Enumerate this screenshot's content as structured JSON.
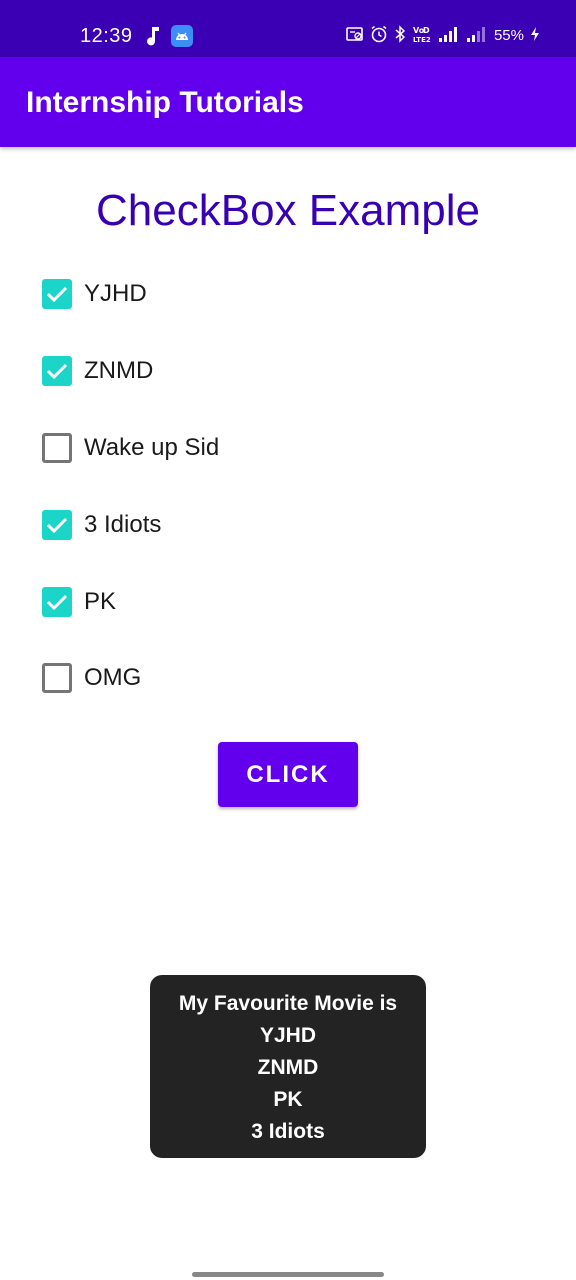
{
  "status_bar": {
    "time": "12:39",
    "battery": "55%",
    "colors": {
      "background": "#3b00b3",
      "foreground": "#ffffff"
    },
    "icons": [
      "music-note-icon",
      "android-app-icon",
      "media-icon",
      "alarm-icon",
      "bluetooth-icon",
      "volte-icon",
      "signal-icon",
      "signal-weak-icon",
      "charging-icon"
    ]
  },
  "app_bar": {
    "title": "Internship Tutorials",
    "color": "#6200ee"
  },
  "main": {
    "heading": "CheckBox Example",
    "heading_color": "#3700b3",
    "checkboxes": [
      {
        "label": "YJHD",
        "checked": true
      },
      {
        "label": "ZNMD",
        "checked": true
      },
      {
        "label": "Wake up Sid",
        "checked": false
      },
      {
        "label": "3 Idiots",
        "checked": true
      },
      {
        "label": "PK",
        "checked": true
      },
      {
        "label": "OMG",
        "checked": false
      }
    ],
    "checkbox_color": "#1bd6c8",
    "button_label": "CLICK"
  },
  "toast": {
    "lines": [
      "My Favourite Movie is",
      "YJHD",
      "ZNMD",
      "PK",
      "3 Idiots"
    ]
  }
}
